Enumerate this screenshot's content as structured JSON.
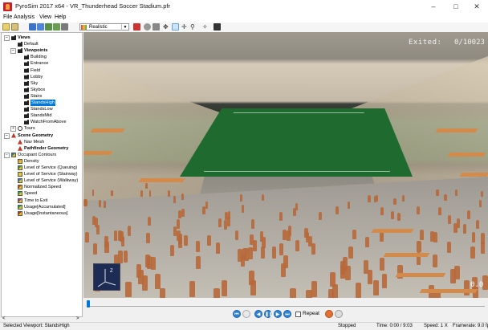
{
  "window": {
    "title": "PyroSim 2017 x64 - VR_Thunderhead Soccer Stadium.pfr",
    "min_glyph": "–",
    "max_glyph": "□",
    "close_glyph": "✕"
  },
  "menu": [
    "File",
    "Analysis",
    "View",
    "Help"
  ],
  "toolbar": {
    "render_mode": "Realistic",
    "icons": [
      "open-folder-icon",
      "save-icon",
      "layers-icon",
      "layers2-icon",
      "layers3-icon",
      "layers4-icon",
      "layers5-icon",
      "palette-icon",
      "flag-icon",
      "orbit-icon",
      "lock-icon",
      "navigate-icon",
      "walk-icon",
      "move-icon",
      "zoom-icon",
      "light-icon",
      "camera-icon"
    ]
  },
  "tree": {
    "items": [
      {
        "label": "Views",
        "indent": 0,
        "toggle": "−",
        "icon": "camera-icon",
        "bold": true
      },
      {
        "label": "Default",
        "indent": 1,
        "icon": "camera-icon"
      },
      {
        "label": "Viewpoints",
        "indent": 1,
        "toggle": "−",
        "icon": "camera-icon",
        "bold": true
      },
      {
        "label": "Building",
        "indent": 2,
        "icon": "camera-icon"
      },
      {
        "label": "Entrance",
        "indent": 2,
        "icon": "camera-icon"
      },
      {
        "label": "Field",
        "indent": 2,
        "icon": "camera-icon"
      },
      {
        "label": "Lobby",
        "indent": 2,
        "icon": "camera-icon"
      },
      {
        "label": "Sky",
        "indent": 2,
        "icon": "camera-icon"
      },
      {
        "label": "Skybox",
        "indent": 2,
        "icon": "camera-icon"
      },
      {
        "label": "Stairs",
        "indent": 2,
        "icon": "camera-icon"
      },
      {
        "label": "StandsHigh",
        "indent": 2,
        "icon": "camera-icon",
        "selected": true
      },
      {
        "label": "StandsLow",
        "indent": 2,
        "icon": "camera-icon"
      },
      {
        "label": "StandsMid",
        "indent": 2,
        "icon": "camera-icon"
      },
      {
        "label": "WatchFromAbove",
        "indent": 2,
        "icon": "camera-icon"
      },
      {
        "label": "Tours",
        "indent": 1,
        "toggle": "+",
        "icon": "tour-icon"
      },
      {
        "label": "Scene Geometry",
        "indent": 0,
        "toggle": "−",
        "icon": "geometry-icon",
        "bold": true
      },
      {
        "label": "Nav Mesh",
        "indent": 1,
        "icon": "geometry-icon"
      },
      {
        "label": "Pathfinder Geometry",
        "indent": 1,
        "icon": "geometry-icon",
        "bold": true
      },
      {
        "label": "Occupant Contours",
        "indent": 0,
        "toggle": "−",
        "icon": "contour-icon"
      },
      {
        "label": "Density",
        "indent": 1,
        "icon": "contour-icon"
      },
      {
        "label": "Level of Service (Queuing)",
        "indent": 1,
        "icon": "contour-icon"
      },
      {
        "label": "Level of Service (Stairway)",
        "indent": 1,
        "icon": "contour-icon"
      },
      {
        "label": "Level of Service (Walkway)",
        "indent": 1,
        "icon": "contour-icon"
      },
      {
        "label": "Normalized Speed",
        "indent": 1,
        "icon": "contour-icon"
      },
      {
        "label": "Speed",
        "indent": 1,
        "icon": "contour-icon"
      },
      {
        "label": "Time to Exit",
        "indent": 1,
        "icon": "contour-icon"
      },
      {
        "label": "Usage[Accumulated]",
        "indent": 1,
        "icon": "contour-icon"
      },
      {
        "label": "Usage[Instantaneous]",
        "indent": 1,
        "icon": "contour-icon"
      }
    ],
    "scroll_left": "<",
    "scroll_right": ">"
  },
  "viewport": {
    "exited_label": "Exited:",
    "exited_count": "0/10023",
    "speed_readout": "0.0",
    "axis_label": "Z"
  },
  "playback": {
    "progress": 0.0,
    "buttons": [
      "skip-start-icon",
      "step-back-icon",
      "play-back-icon",
      "pause-icon",
      "play-icon",
      "skip-end-icon"
    ],
    "repeat_label": "Repeat",
    "extra_icons": [
      "record-icon",
      "camera-path-icon"
    ]
  },
  "status": {
    "left": "Selected Viewport: StandsHigh",
    "state": "Stopped",
    "time": "Time: 0:00 / 9:03",
    "speed": "Speed: 1 X",
    "framerate": "Framerate: 9.0 fps"
  },
  "colors": {
    "selection": "#0078d7",
    "playback_blue": "#2f86d6",
    "figure_orange": "#b8683a"
  }
}
